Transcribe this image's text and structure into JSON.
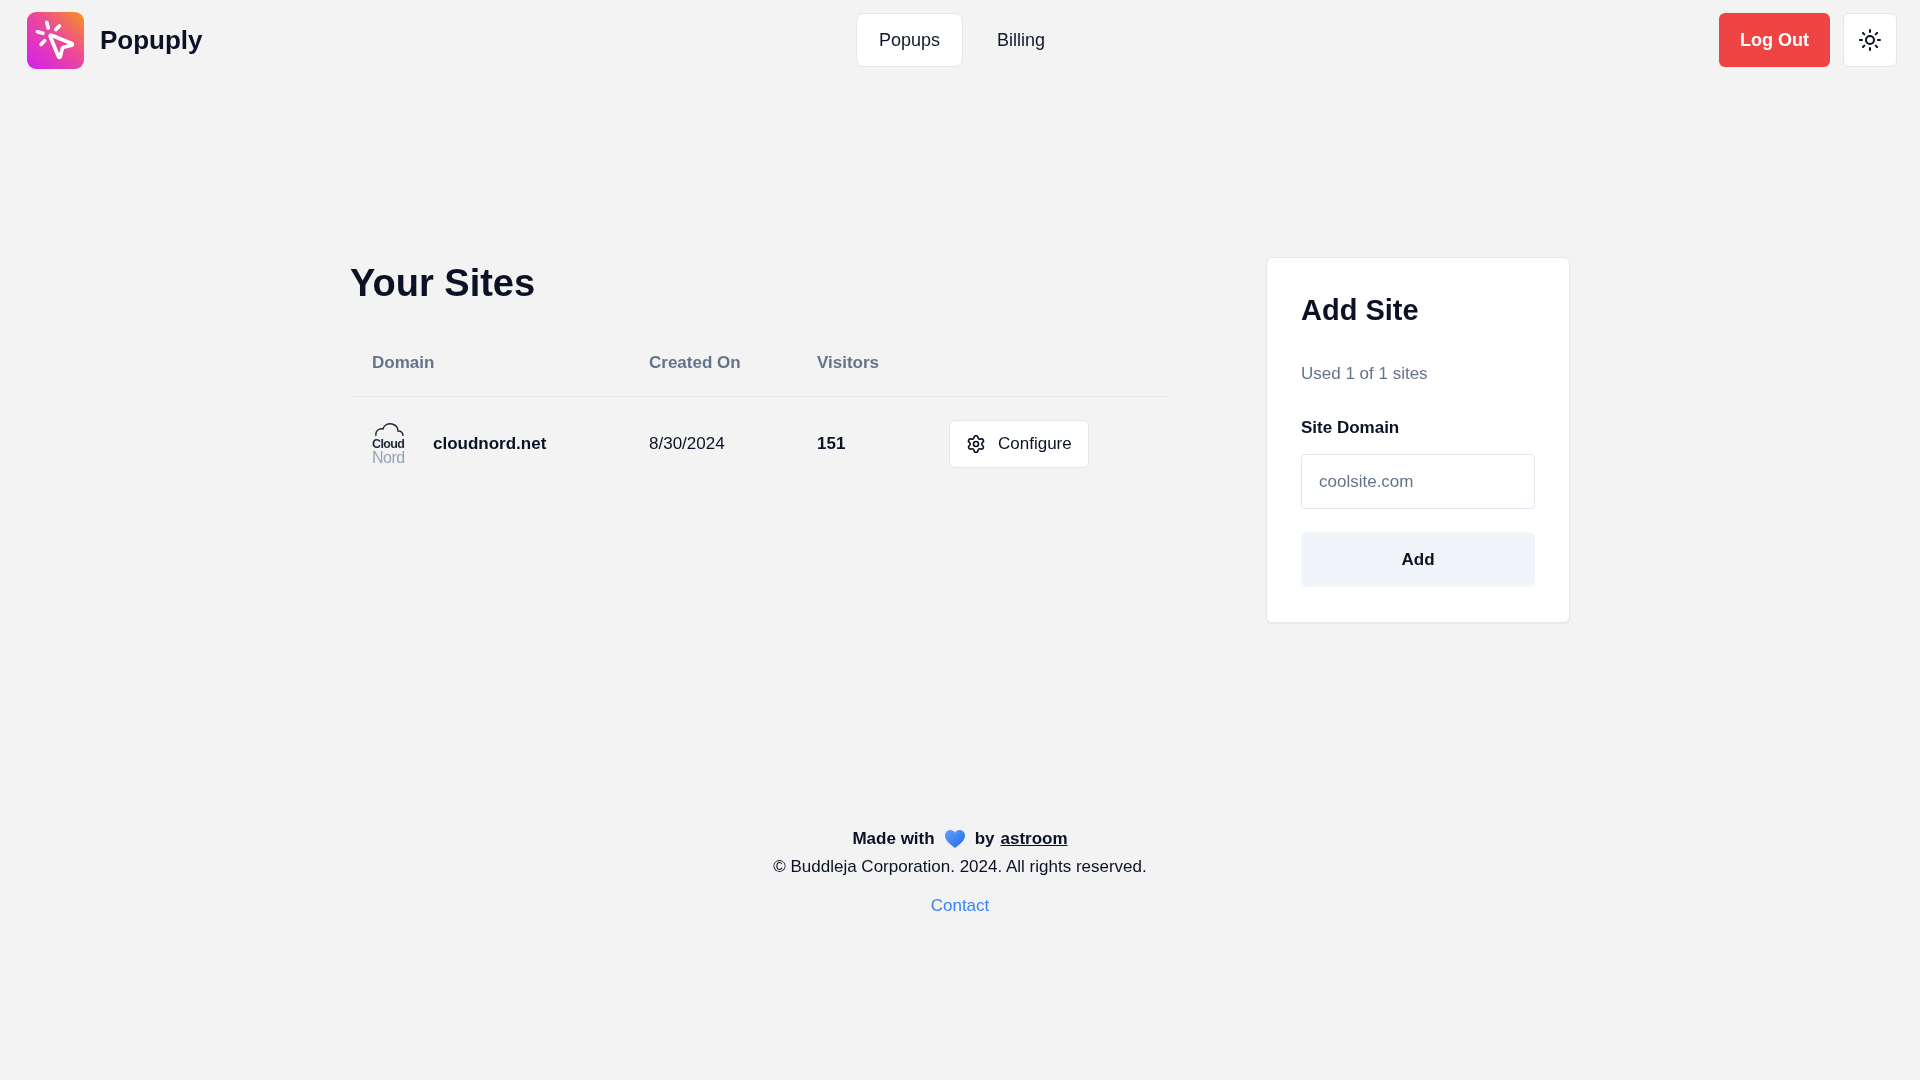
{
  "header": {
    "brand": "Popuply",
    "nav": [
      {
        "label": "Popups",
        "selected": true
      },
      {
        "label": "Billing",
        "selected": false
      }
    ],
    "logout": "Log Out"
  },
  "sites": {
    "title": "Your Sites",
    "columns": [
      "Domain",
      "Created On",
      "Visitors"
    ],
    "rows": [
      {
        "logo": [
          "Cloud",
          "Nord"
        ],
        "domain": "cloudnord.net",
        "created_on": "8/30/2024",
        "visitors": "151",
        "action": "Configure"
      }
    ]
  },
  "add_site": {
    "title": "Add Site",
    "usage": "Used 1 of 1 sites",
    "field_label": "Site Domain",
    "placeholder": "coolsite.com",
    "button": "Add"
  },
  "footer": {
    "credit": "Made with",
    "credit_by": "by",
    "credit_link": "astroom",
    "copyright": "© Buddleja Corporation. 2024. All rights reserved.",
    "contact": "Contact"
  }
}
